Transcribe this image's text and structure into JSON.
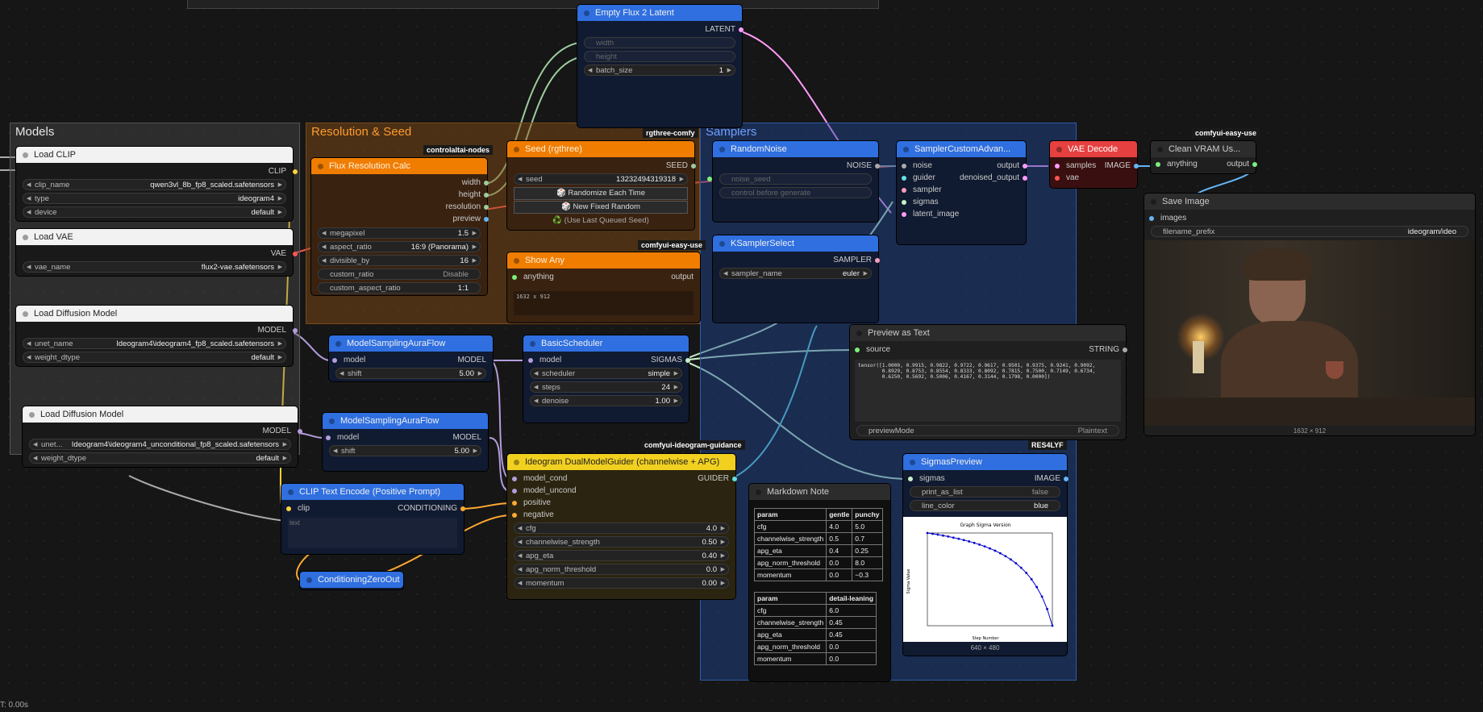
{
  "groups": {
    "models": "Models",
    "res_seed": "Resolution & Seed",
    "samplers": "Samplers"
  },
  "badges": {
    "controlaltai": "controlaltai-nodes",
    "rgthree": "rgthree-comfy",
    "easyuse1": "comfyui-easy-use",
    "easyuse2": "comfyui-easy-use",
    "ideogram": "comfyui-ideogram-guidance",
    "res4lyf": "RES4LYF"
  },
  "load_clip": {
    "title": "Load CLIP",
    "out": "CLIP",
    "clip_name": "clip_name",
    "clip_name_v": "qwen3vl_8b_fp8_scaled.safetensors",
    "type": "type",
    "type_v": "ideogram4",
    "device": "device",
    "device_v": "default"
  },
  "load_vae": {
    "title": "Load VAE",
    "out": "VAE",
    "vae_name": "vae_name",
    "vae_name_v": "flux2-vae.safetensors"
  },
  "load_diff1": {
    "title": "Load Diffusion Model",
    "out": "MODEL",
    "unet": "unet_name",
    "unet_v": "Ideogram4\\ideogram4_fp8_scaled.safetensors",
    "wd": "weight_dtype",
    "wd_v": "default"
  },
  "load_diff2": {
    "title": "Load Diffusion Model",
    "out": "MODEL",
    "unet": "unet...",
    "unet_v": "Ideogram4\\ideogram4_unconditional_fp8_scaled.safetensors",
    "wd": "weight_dtype",
    "wd_v": "default"
  },
  "flux_res": {
    "title": "Flux Resolution Calc",
    "o1": "width",
    "o2": "height",
    "o3": "resolution",
    "o4": "preview",
    "mp": "megapixel",
    "mp_v": "1.5",
    "ar": "aspect_ratio",
    "ar_v": "16:9 (Panorama)",
    "div": "divisible_by",
    "div_v": "16",
    "cr": "custom_ratio",
    "cr_v": "Disable",
    "car": "custom_aspect_ratio",
    "car_v": "1:1"
  },
  "seed": {
    "title": "Seed (rgthree)",
    "out": "SEED",
    "seed": "seed",
    "seed_v": "13232494319318",
    "b1": "🎲 Randomize Each Time",
    "b2": "🎲 New Fixed Random",
    "b3": "♻️ (Use Last Queued Seed)"
  },
  "show_any": {
    "title": "Show Any",
    "in": "anything",
    "out": "output",
    "text": "1632 x 912"
  },
  "empty_latent": {
    "title": "Empty Flux 2 Latent",
    "out": "LATENT",
    "w": "width",
    "h": "height",
    "bs": "batch_size",
    "bs_v": "1"
  },
  "msaf1": {
    "title": "ModelSamplingAuraFlow",
    "in": "model",
    "out": "MODEL",
    "shift": "shift",
    "shift_v": "5.00"
  },
  "msaf2": {
    "title": "ModelSamplingAuraFlow",
    "in": "model",
    "out": "MODEL",
    "shift": "shift",
    "shift_v": "5.00"
  },
  "basic_sched": {
    "title": "BasicScheduler",
    "in": "model",
    "out": "SIGMAS",
    "sched": "scheduler",
    "sched_v": "simple",
    "steps": "steps",
    "steps_v": "24",
    "den": "denoise",
    "den_v": "1.00"
  },
  "random_noise": {
    "title": "RandomNoise",
    "out": "NOISE",
    "ns": "noise_seed",
    "cbg": "control before generate"
  },
  "ksampler_sel": {
    "title": "KSamplerSelect",
    "out": "SAMPLER",
    "sn": "sampler_name",
    "sn_v": "euler"
  },
  "sampler_custom": {
    "title": "SamplerCustomAdvan...",
    "i1": "noise",
    "i2": "guider",
    "i3": "sampler",
    "i4": "sigmas",
    "i5": "latent_image",
    "o1": "output",
    "o2": "denoised_output"
  },
  "vae_decode": {
    "title": "VAE Decode",
    "i1": "samples",
    "i2": "vae",
    "out": "IMAGE"
  },
  "clean_vram": {
    "title": "Clean VRAM Us...",
    "in": "anything",
    "out": "output"
  },
  "save_image": {
    "title": "Save Image",
    "in": "images",
    "fp": "filename_prefix",
    "fp_v": "ideogram/ideo",
    "size": "1632 × 912"
  },
  "preview_text": {
    "title": "Preview as Text",
    "in": "source",
    "out": "STRING",
    "text": "tensor([1.0000, 0.9915, 0.9822, 0.9722, 0.9617, 0.9501, 0.9375, 0.9241, 0.9092,\n        0.8929, 0.8753, 0.8554, 0.8333, 0.8092, 0.7815, 0.7500, 0.7149, 0.6734,\n        0.6250, 0.5692, 0.5006, 0.4167, 0.3144, 0.1798, 0.0000])",
    "pm": "previewMode",
    "pm_v": "Plaintext"
  },
  "sigmas_preview": {
    "title": "SigmasPreview",
    "in": "sigmas",
    "out": "IMAGE",
    "pal": "print_as_list",
    "pal_v": "false",
    "lc": "line_color",
    "lc_v": "blue",
    "size": "640 × 480",
    "chart_title": "Graph Sigma Version",
    "xlabel": "Step Number",
    "ylabel": "Sigma Value"
  },
  "clip_text": {
    "title": "CLIP Text Encode (Positive Prompt)",
    "in": "clip",
    "out": "CONDITIONING",
    "placeholder": "text"
  },
  "cond_zero": {
    "title": "ConditioningZeroOut"
  },
  "ideogram": {
    "title": "Ideogram DualModelGuider (channelwise + APG)",
    "i1": "model_cond",
    "i2": "model_uncond",
    "i3": "positive",
    "i4": "negative",
    "out": "GUIDER",
    "cfg": "cfg",
    "cfg_v": "4.0",
    "cs": "channelwise_strength",
    "cs_v": "0.50",
    "ae": "apg_eta",
    "ae_v": "0.40",
    "ant": "apg_norm_threshold",
    "ant_v": "0.0",
    "mom": "momentum",
    "mom_v": "0.00"
  },
  "markdown": {
    "title": "Markdown Note",
    "t1_head": [
      "param",
      "gentle",
      "punchy"
    ],
    "t1_rows": [
      [
        "cfg",
        "4.0",
        "5.0"
      ],
      [
        "channelwise_strength",
        "0.5",
        "0.7"
      ],
      [
        "apg_eta",
        "0.4",
        "0.25"
      ],
      [
        "apg_norm_threshold",
        "0.0",
        "8.0"
      ],
      [
        "momentum",
        "0.0",
        "−0.3"
      ]
    ],
    "t2_head": [
      "param",
      "detail-leaning"
    ],
    "t2_rows": [
      [
        "cfg",
        "6.0"
      ],
      [
        "channelwise_strength",
        "0.45"
      ],
      [
        "apg_eta",
        "0.45"
      ],
      [
        "apg_norm_threshold",
        "0.0"
      ],
      [
        "momentum",
        "0.0"
      ]
    ]
  },
  "status": "T: 0.00s",
  "chart_data": {
    "type": "line",
    "title": "Graph Sigma Version",
    "xlabel": "Step Number",
    "ylabel": "Sigma Value",
    "x": [
      0,
      1,
      2,
      3,
      4,
      5,
      6,
      7,
      8,
      9,
      10,
      11,
      12,
      13,
      14,
      15,
      16,
      17,
      18,
      19,
      20,
      21,
      22,
      23,
      24
    ],
    "values": [
      1.0,
      0.9915,
      0.9822,
      0.9722,
      0.9617,
      0.9501,
      0.9375,
      0.9241,
      0.9092,
      0.8929,
      0.8753,
      0.8554,
      0.8333,
      0.8092,
      0.7815,
      0.75,
      0.7149,
      0.6734,
      0.625,
      0.5692,
      0.5006,
      0.4167,
      0.3144,
      0.1798,
      0.0
    ],
    "ylim": [
      0,
      1
    ],
    "xlim": [
      0,
      24
    ],
    "color": "#0000cc"
  }
}
